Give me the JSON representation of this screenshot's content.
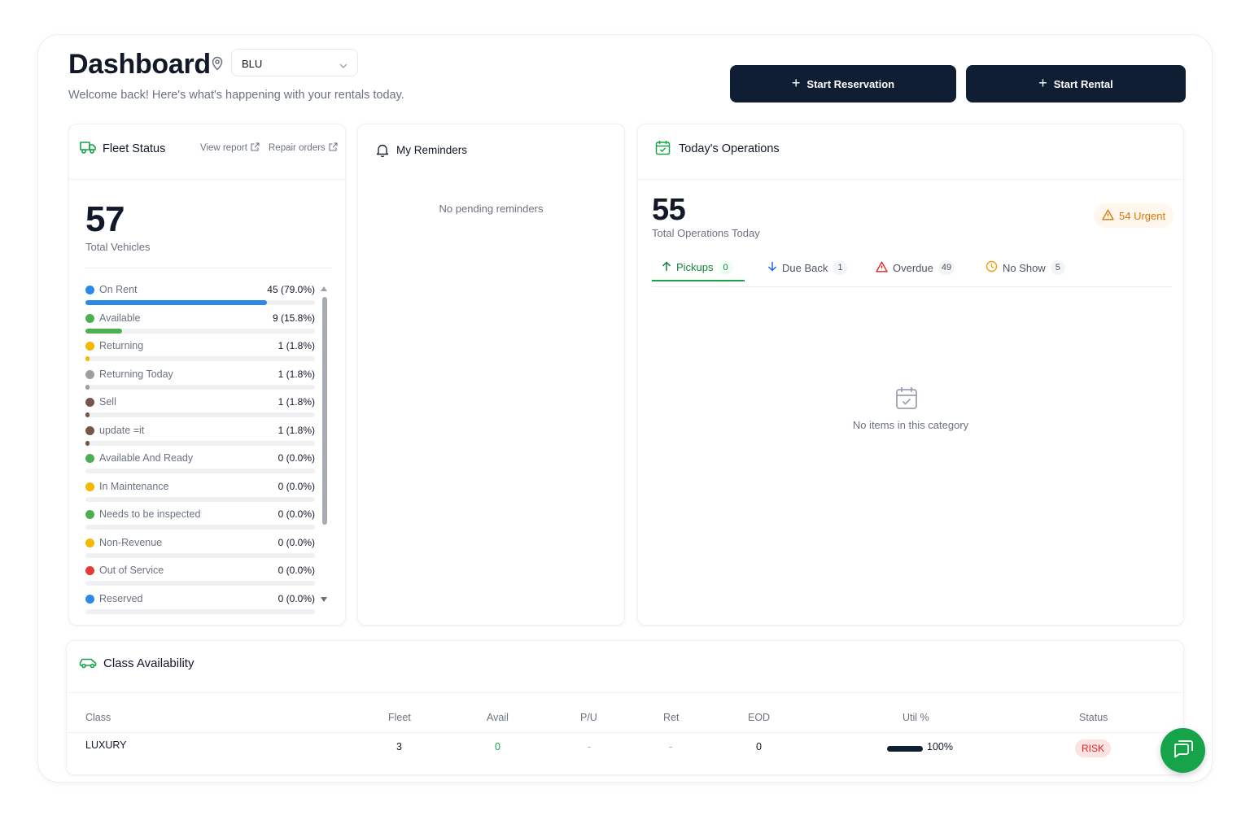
{
  "header": {
    "title": "Dashboard",
    "location": "BLU",
    "subtitle": "Welcome back! Here's what's happening with your rentals today.",
    "start_reservation": "Start Reservation",
    "start_rental": "Start Rental"
  },
  "fleet": {
    "title": "Fleet Status",
    "view_report": "View report",
    "repair_orders": "Repair orders",
    "total": "57",
    "total_label": "Total Vehicles",
    "statuses": [
      {
        "label": "On Rent",
        "value": "45 (79.0%)",
        "pct": 79.0,
        "color": "#2b8ae6"
      },
      {
        "label": "Available",
        "value": "9 (15.8%)",
        "pct": 15.8,
        "color": "#4caf50"
      },
      {
        "label": "Returning",
        "value": "1 (1.8%)",
        "pct": 1.8,
        "color": "#f5b800"
      },
      {
        "label": "Returning Today",
        "value": "1 (1.8%)",
        "pct": 1.8,
        "color": "#9e9e9e"
      },
      {
        "label": "Sell",
        "value": "1 (1.8%)",
        "pct": 1.8,
        "color": "#795548"
      },
      {
        "label": "update =it",
        "value": "1 (1.8%)",
        "pct": 1.8,
        "color": "#795548"
      },
      {
        "label": "Available And Ready",
        "value": "0 (0.0%)",
        "pct": 0,
        "color": "#4caf50"
      },
      {
        "label": "In Maintenance",
        "value": "0 (0.0%)",
        "pct": 0,
        "color": "#f5b800"
      },
      {
        "label": "Needs to be inspected",
        "value": "0 (0.0%)",
        "pct": 0,
        "color": "#4caf50"
      },
      {
        "label": "Non-Revenue",
        "value": "0 (0.0%)",
        "pct": 0,
        "color": "#f5b800"
      },
      {
        "label": "Out of Service",
        "value": "0 (0.0%)",
        "pct": 0,
        "color": "#e53935"
      },
      {
        "label": "Reserved",
        "value": "0 (0.0%)",
        "pct": 0,
        "color": "#2b8ae6"
      }
    ]
  },
  "reminders": {
    "title": "My Reminders",
    "empty": "No pending reminders"
  },
  "operations": {
    "title": "Today's Operations",
    "total": "55",
    "total_label": "Total Operations Today",
    "urgent": "54 Urgent",
    "tabs": [
      {
        "label": "Pickups",
        "count": "0"
      },
      {
        "label": "Due Back",
        "count": "1"
      },
      {
        "label": "Overdue",
        "count": "49"
      },
      {
        "label": "No Show",
        "count": "5"
      }
    ],
    "empty": "No items in this category"
  },
  "class_availability": {
    "title": "Class Availability",
    "columns": [
      "Class",
      "Fleet",
      "Avail",
      "P/U",
      "Ret",
      "EOD",
      "Util %",
      "Status"
    ],
    "rows": [
      {
        "class": "LUXURY",
        "fleet": "3",
        "avail": "0",
        "pu": "-",
        "ret": "-",
        "eod": "0",
        "util": "100%",
        "util_pct": 100,
        "status": "RISK"
      }
    ]
  },
  "colors": {
    "primary": "#0f1e33",
    "accent_green": "#16a34a",
    "urgent": "#d97706",
    "risk": "#dc2626"
  },
  "icons": [
    "map-pin-icon",
    "chevron-down-icon",
    "plus-icon",
    "truck-icon",
    "external-link-icon",
    "bell-icon",
    "calendar-check-icon",
    "alert-triangle-icon",
    "arrow-up-icon",
    "arrow-down-icon",
    "clock-icon",
    "car-icon",
    "chat-icon"
  ]
}
